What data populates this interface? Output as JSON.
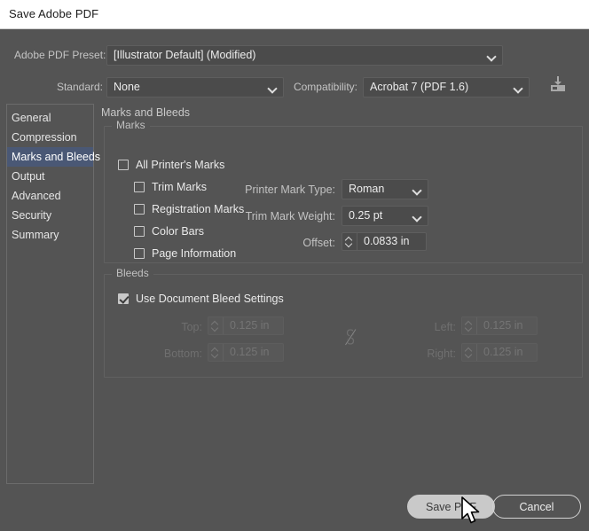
{
  "window": {
    "title": "Save Adobe PDF"
  },
  "top": {
    "preset_label": "Adobe PDF Preset:",
    "preset_value": "[Illustrator Default] (Modified)",
    "standard_label": "Standard:",
    "standard_value": "None",
    "compatibility_label": "Compatibility:",
    "compatibility_value": "Acrobat 7 (PDF 1.6)",
    "save_preset_icon": "save-preset-icon"
  },
  "sidebar": {
    "items": [
      {
        "label": "General",
        "selected": false
      },
      {
        "label": "Compression",
        "selected": false
      },
      {
        "label": "Marks and Bleeds",
        "selected": true
      },
      {
        "label": "Output",
        "selected": false
      },
      {
        "label": "Advanced",
        "selected": false
      },
      {
        "label": "Security",
        "selected": false
      },
      {
        "label": "Summary",
        "selected": false
      }
    ]
  },
  "panel": {
    "title": "Marks and Bleeds",
    "marks": {
      "group_label": "Marks",
      "checkboxes": [
        {
          "label": "All Printer's Marks",
          "checked": false
        },
        {
          "label": "Trim Marks",
          "checked": false
        },
        {
          "label": "Registration Marks",
          "checked": false
        },
        {
          "label": "Color Bars",
          "checked": false
        },
        {
          "label": "Page Information",
          "checked": false
        }
      ],
      "printer_mark_type_label": "Printer Mark Type:",
      "printer_mark_type_value": "Roman",
      "trim_mark_weight_label": "Trim Mark Weight:",
      "trim_mark_weight_value": "0.25 pt",
      "offset_label": "Offset:",
      "offset_value": "0.0833 in"
    },
    "bleeds": {
      "group_label": "Bleeds",
      "use_document_bleed_label": "Use Document Bleed Settings",
      "use_document_bleed_checked": true,
      "link_icon": "broken-link-icon",
      "top_label": "Top:",
      "top_value": "0.125 in",
      "bottom_label": "Bottom:",
      "bottom_value": "0.125 in",
      "left_label": "Left:",
      "left_value": "0.125 in",
      "right_label": "Right:",
      "right_value": "0.125 in"
    }
  },
  "footer": {
    "save_label": "Save PDF",
    "cancel_label": "Cancel"
  },
  "colors": {
    "dialog_bg": "#545454",
    "titlebar_bg": "#ffffff",
    "selection_blue": "#4a5875",
    "field_bg": "#4b4b4b",
    "text": "#eaeaea",
    "disabled_text": "#6f6f6f",
    "primary_button": "#c9c9c9"
  }
}
